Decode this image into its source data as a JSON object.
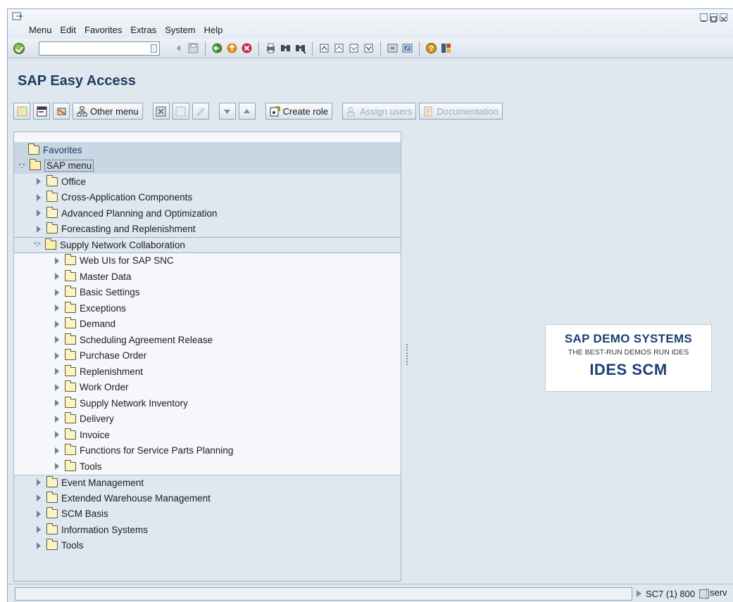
{
  "menubar": {
    "items": [
      "Menu",
      "Edit",
      "Favorites",
      "Extras",
      "System",
      "Help"
    ]
  },
  "app": {
    "title": "SAP Easy Access"
  },
  "toolbar": {
    "other_menu": "Other menu",
    "create_role": "Create role",
    "assign_users": "Assign users",
    "documentation": "Documentation"
  },
  "tree": {
    "favorites": "Favorites",
    "sap_menu": "SAP menu",
    "level1_before": [
      "Office",
      "Cross-Application Components",
      "Advanced Planning and Optimization",
      "Forecasting and Replenishment"
    ],
    "expanded": "Supply Network Collaboration",
    "children": [
      "Web UIs for SAP SNC",
      "Master Data",
      "Basic Settings",
      "Exceptions",
      "Demand",
      "Scheduling Agreement Release",
      "Purchase Order",
      "Replenishment",
      "Work Order",
      "Supply Network Inventory",
      "Delivery",
      "Invoice",
      "Functions for Service Parts Planning",
      "Tools"
    ],
    "level1_after": [
      "Event Management",
      "Extended Warehouse Management",
      "SCM Basis",
      "Information Systems",
      "Tools"
    ]
  },
  "demo": {
    "line1": "SAP DEMO SYSTEMS",
    "line2": "THE BEST-RUN DEMOS RUN IDES",
    "line3": "IDES SCM"
  },
  "status": {
    "system": "SC7 (1) 800",
    "server": "serv"
  },
  "colors": {
    "title_blue": "#1f3d63",
    "demo_blue": "#1b3f74",
    "tree_bg": "#f5f7fa",
    "frame_bg": "#dfe7ef"
  }
}
